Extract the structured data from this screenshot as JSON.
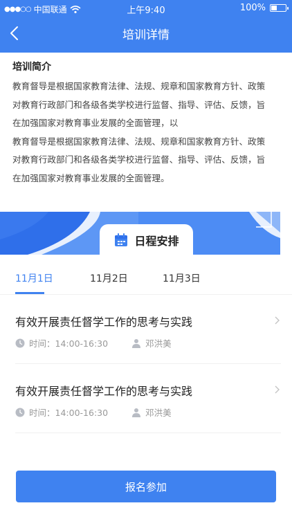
{
  "status_bar": {
    "carrier": "中国联通",
    "time": "上午9:40",
    "battery": "100%"
  },
  "nav": {
    "title": "培训详情"
  },
  "intro": {
    "heading": "培训简介",
    "lines": [
      "教育督导是根据国家教育法律、法规、规章和国家教育方针、政策",
      "对教育行政部门和各级各类学校进行监督、指导、评估、反馈，旨",
      "在加强国家对教育事业发展的全面管理，以",
      "教育督导是根据国家教育法律、法规、规章和国家教育方针、政策",
      "对教育行政部门和各级各类学校进行监督、指导、评估、反馈，旨",
      "在加强国家对教育事业发展的全面管理。"
    ]
  },
  "schedule": {
    "label": "日程安排"
  },
  "tabs": [
    {
      "label": "11月1日",
      "active": true
    },
    {
      "label": "11月2日",
      "active": false
    },
    {
      "label": "11月3日",
      "active": false
    }
  ],
  "sessions": [
    {
      "title": "有效开展责任督学工作的思考与实践",
      "time": "时间：14:00-16:30",
      "speaker": "邓洪美"
    },
    {
      "title": "有效开展责任督学工作的思考与实践",
      "time": "时间：14:00-16:30",
      "speaker": "邓洪美"
    }
  ],
  "signup_label": "报名参加",
  "colors": {
    "primary": "#3f82f0",
    "text": "#222222",
    "muted": "#999999"
  }
}
